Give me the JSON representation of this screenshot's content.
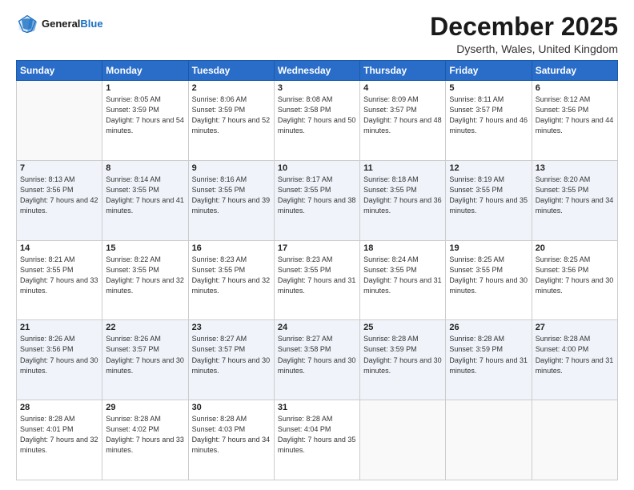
{
  "header": {
    "logo_line1": "General",
    "logo_line2": "Blue",
    "month": "December 2025",
    "location": "Dyserth, Wales, United Kingdom"
  },
  "days_of_week": [
    "Sunday",
    "Monday",
    "Tuesday",
    "Wednesday",
    "Thursday",
    "Friday",
    "Saturday"
  ],
  "weeks": [
    [
      {
        "day": "",
        "info": ""
      },
      {
        "day": "1",
        "info": "Sunrise: 8:05 AM\nSunset: 3:59 PM\nDaylight: 7 hours\nand 54 minutes."
      },
      {
        "day": "2",
        "info": "Sunrise: 8:06 AM\nSunset: 3:59 PM\nDaylight: 7 hours\nand 52 minutes."
      },
      {
        "day": "3",
        "info": "Sunrise: 8:08 AM\nSunset: 3:58 PM\nDaylight: 7 hours\nand 50 minutes."
      },
      {
        "day": "4",
        "info": "Sunrise: 8:09 AM\nSunset: 3:57 PM\nDaylight: 7 hours\nand 48 minutes."
      },
      {
        "day": "5",
        "info": "Sunrise: 8:11 AM\nSunset: 3:57 PM\nDaylight: 7 hours\nand 46 minutes."
      },
      {
        "day": "6",
        "info": "Sunrise: 8:12 AM\nSunset: 3:56 PM\nDaylight: 7 hours\nand 44 minutes."
      }
    ],
    [
      {
        "day": "7",
        "info": "Sunrise: 8:13 AM\nSunset: 3:56 PM\nDaylight: 7 hours\nand 42 minutes."
      },
      {
        "day": "8",
        "info": "Sunrise: 8:14 AM\nSunset: 3:55 PM\nDaylight: 7 hours\nand 41 minutes."
      },
      {
        "day": "9",
        "info": "Sunrise: 8:16 AM\nSunset: 3:55 PM\nDaylight: 7 hours\nand 39 minutes."
      },
      {
        "day": "10",
        "info": "Sunrise: 8:17 AM\nSunset: 3:55 PM\nDaylight: 7 hours\nand 38 minutes."
      },
      {
        "day": "11",
        "info": "Sunrise: 8:18 AM\nSunset: 3:55 PM\nDaylight: 7 hours\nand 36 minutes."
      },
      {
        "day": "12",
        "info": "Sunrise: 8:19 AM\nSunset: 3:55 PM\nDaylight: 7 hours\nand 35 minutes."
      },
      {
        "day": "13",
        "info": "Sunrise: 8:20 AM\nSunset: 3:55 PM\nDaylight: 7 hours\nand 34 minutes."
      }
    ],
    [
      {
        "day": "14",
        "info": "Sunrise: 8:21 AM\nSunset: 3:55 PM\nDaylight: 7 hours\nand 33 minutes."
      },
      {
        "day": "15",
        "info": "Sunrise: 8:22 AM\nSunset: 3:55 PM\nDaylight: 7 hours\nand 32 minutes."
      },
      {
        "day": "16",
        "info": "Sunrise: 8:23 AM\nSunset: 3:55 PM\nDaylight: 7 hours\nand 32 minutes."
      },
      {
        "day": "17",
        "info": "Sunrise: 8:23 AM\nSunset: 3:55 PM\nDaylight: 7 hours\nand 31 minutes."
      },
      {
        "day": "18",
        "info": "Sunrise: 8:24 AM\nSunset: 3:55 PM\nDaylight: 7 hours\nand 31 minutes."
      },
      {
        "day": "19",
        "info": "Sunrise: 8:25 AM\nSunset: 3:55 PM\nDaylight: 7 hours\nand 30 minutes."
      },
      {
        "day": "20",
        "info": "Sunrise: 8:25 AM\nSunset: 3:56 PM\nDaylight: 7 hours\nand 30 minutes."
      }
    ],
    [
      {
        "day": "21",
        "info": "Sunrise: 8:26 AM\nSunset: 3:56 PM\nDaylight: 7 hours\nand 30 minutes."
      },
      {
        "day": "22",
        "info": "Sunrise: 8:26 AM\nSunset: 3:57 PM\nDaylight: 7 hours\nand 30 minutes."
      },
      {
        "day": "23",
        "info": "Sunrise: 8:27 AM\nSunset: 3:57 PM\nDaylight: 7 hours\nand 30 minutes."
      },
      {
        "day": "24",
        "info": "Sunrise: 8:27 AM\nSunset: 3:58 PM\nDaylight: 7 hours\nand 30 minutes."
      },
      {
        "day": "25",
        "info": "Sunrise: 8:28 AM\nSunset: 3:59 PM\nDaylight: 7 hours\nand 30 minutes."
      },
      {
        "day": "26",
        "info": "Sunrise: 8:28 AM\nSunset: 3:59 PM\nDaylight: 7 hours\nand 31 minutes."
      },
      {
        "day": "27",
        "info": "Sunrise: 8:28 AM\nSunset: 4:00 PM\nDaylight: 7 hours\nand 31 minutes."
      }
    ],
    [
      {
        "day": "28",
        "info": "Sunrise: 8:28 AM\nSunset: 4:01 PM\nDaylight: 7 hours\nand 32 minutes."
      },
      {
        "day": "29",
        "info": "Sunrise: 8:28 AM\nSunset: 4:02 PM\nDaylight: 7 hours\nand 33 minutes."
      },
      {
        "day": "30",
        "info": "Sunrise: 8:28 AM\nSunset: 4:03 PM\nDaylight: 7 hours\nand 34 minutes."
      },
      {
        "day": "31",
        "info": "Sunrise: 8:28 AM\nSunset: 4:04 PM\nDaylight: 7 hours\nand 35 minutes."
      },
      {
        "day": "",
        "info": ""
      },
      {
        "day": "",
        "info": ""
      },
      {
        "day": "",
        "info": ""
      }
    ]
  ]
}
